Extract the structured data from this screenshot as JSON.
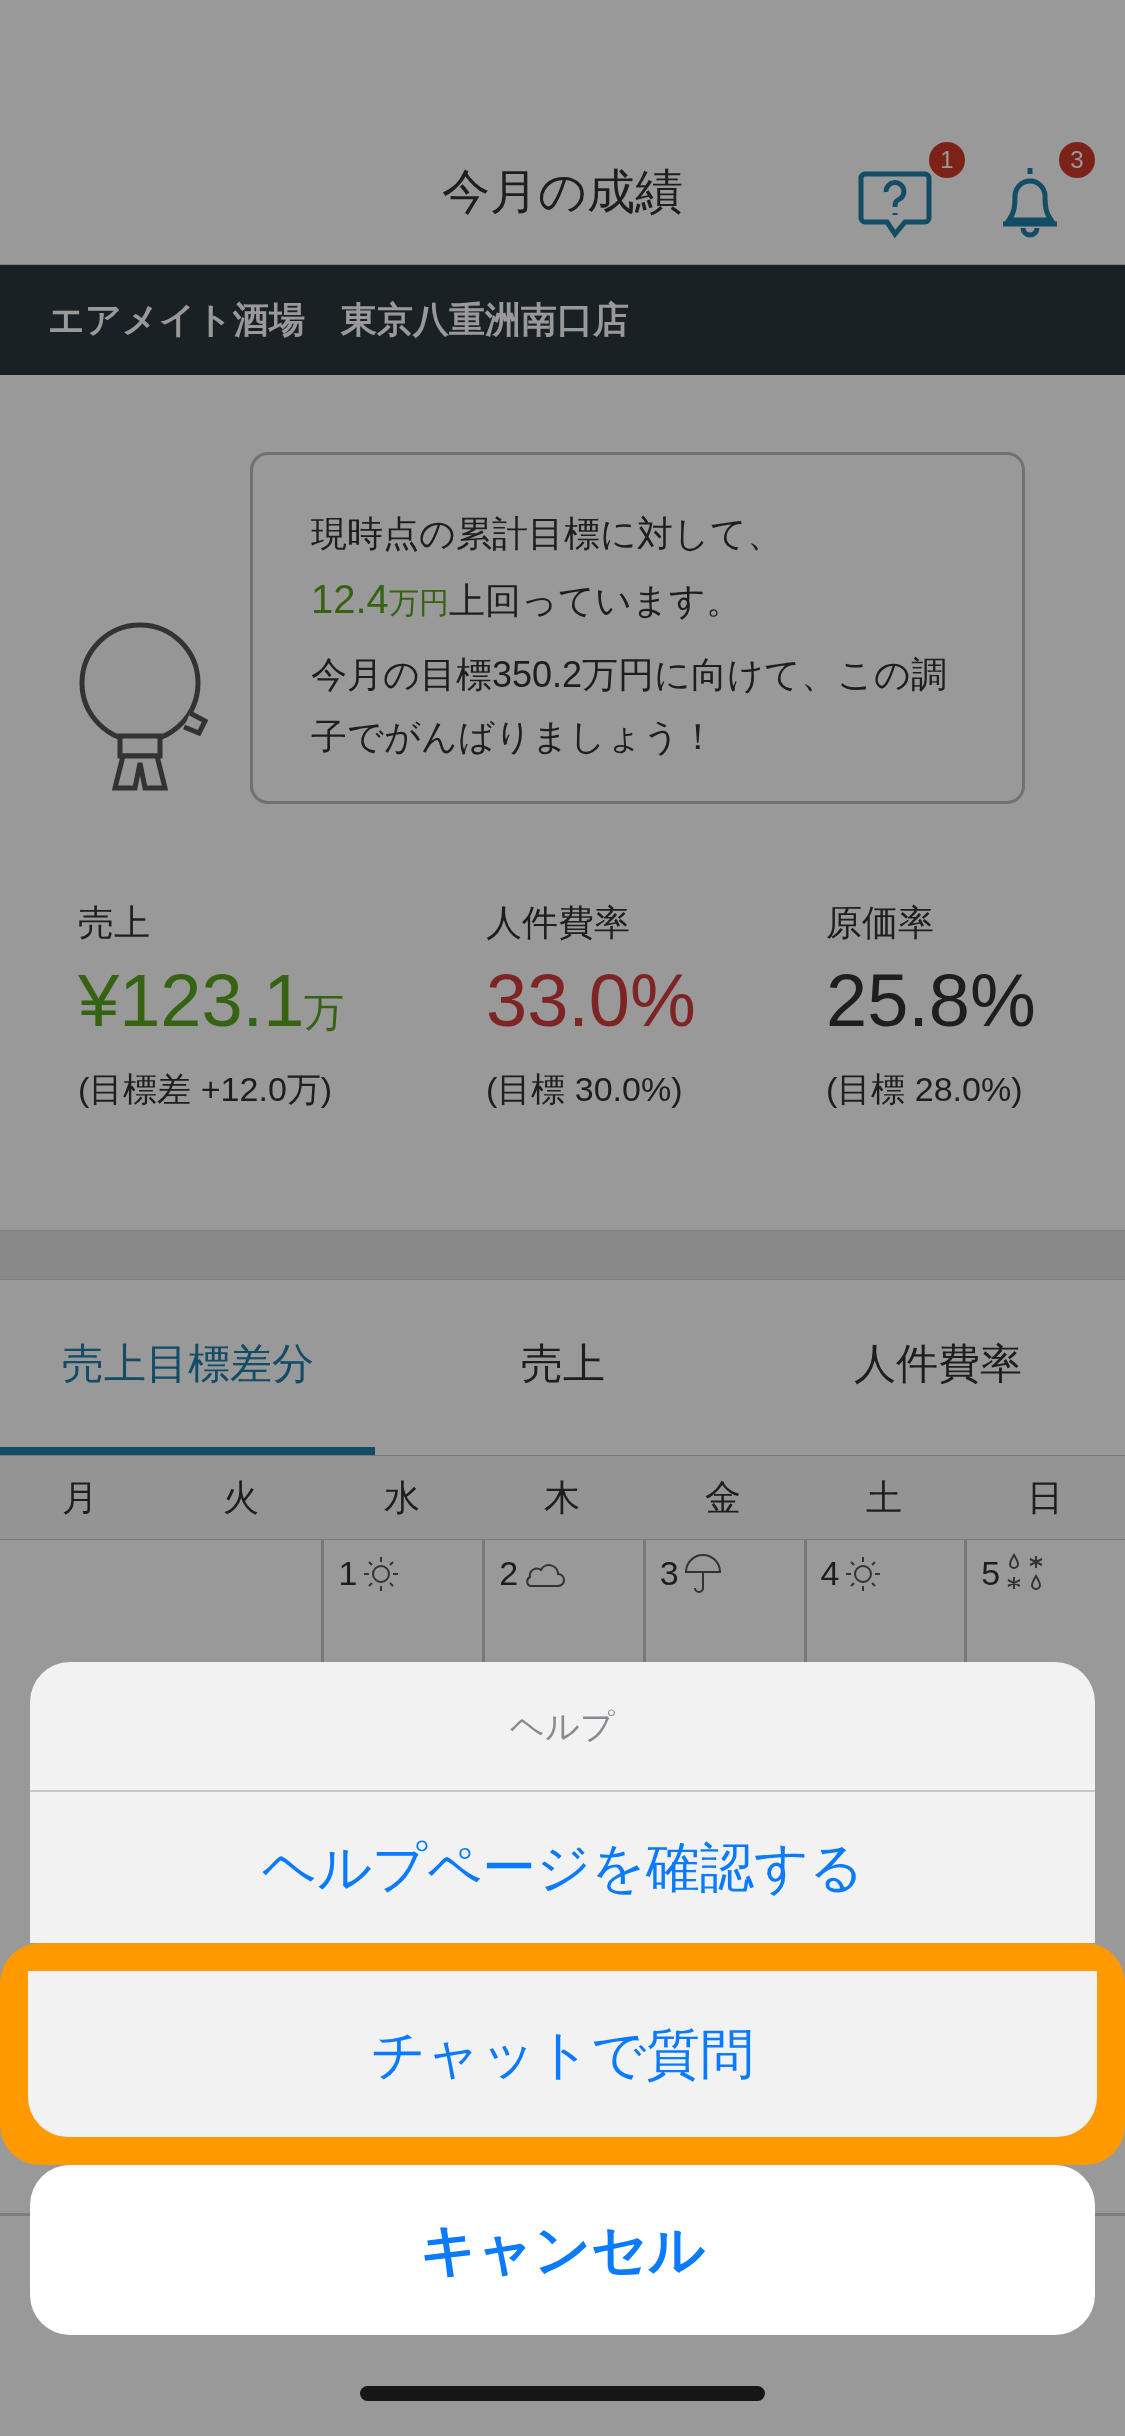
{
  "header": {
    "title": "今月の成績",
    "help_badge": "1",
    "notification_badge": "3"
  },
  "store_name": "エアメイト酒場　東京八重洲南口店",
  "message": {
    "line1": "現時点の累計目標に対して、",
    "highlight": "12.4",
    "highlight_unit": "万円",
    "after_highlight": "上回っています。",
    "line3": "今月の目標350.2万円に向けて、この調子でがんばりましょう！"
  },
  "metrics": [
    {
      "label": "売上",
      "prefix": "¥",
      "value": "123.1",
      "unit": "万",
      "sub": "(目標差 +12.0万)",
      "kind": "good"
    },
    {
      "label": "人件費率",
      "value": "33.0%",
      "sub": "(目標 30.0%)",
      "kind": "bad"
    },
    {
      "label": "原価率",
      "value": "25.8%",
      "sub": "(目標 28.0%)",
      "kind": "neutral"
    }
  ],
  "tabs": [
    {
      "label": "売上目標差分",
      "selected": true
    },
    {
      "label": "売上",
      "selected": false
    },
    {
      "label": "人件費率",
      "selected": false
    }
  ],
  "weekdays": [
    "月",
    "火",
    "水",
    "木",
    "金",
    "土",
    "日"
  ],
  "days": [
    {
      "kind": "blank"
    },
    {
      "kind": "blank"
    },
    {
      "kind": "sun",
      "date": "1"
    },
    {
      "kind": "cloud",
      "date": "2"
    },
    {
      "kind": "rain",
      "date": "3"
    },
    {
      "kind": "sun",
      "date": "4"
    },
    {
      "kind": "sleet",
      "date": "5"
    }
  ],
  "sheet": {
    "title": "ヘルプ",
    "actions": [
      {
        "label": "ヘルプページを確認する",
        "highlighted": false
      },
      {
        "label": "チャットで質問",
        "highlighted": true
      }
    ],
    "cancel": "キャンセル"
  }
}
